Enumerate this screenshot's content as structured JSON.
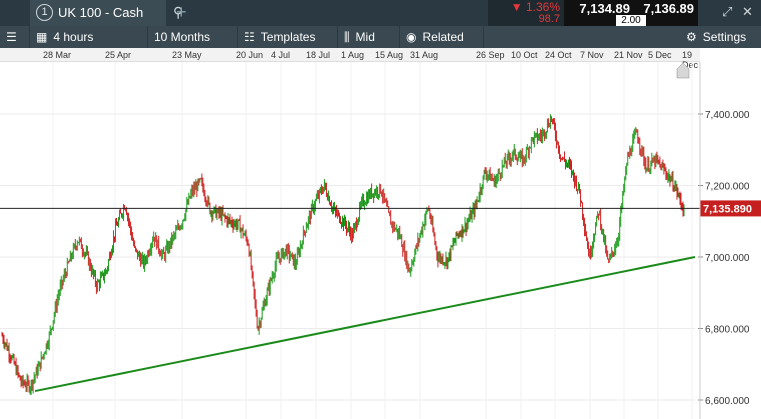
{
  "tab": {
    "number": "1",
    "title": "UK 100 - Cash"
  },
  "quote": {
    "change_pct": "▼ 1.36%",
    "change_pts": "98.7",
    "sell": "7,134.89",
    "buy": "7,136.89",
    "spread": "2.00"
  },
  "toolbar": {
    "interval": "4 hours",
    "range": "10 Months",
    "templates": "Templates",
    "price_type": "Mid",
    "related": "Related",
    "settings": "Settings"
  },
  "date_labels": [
    "28 Mar",
    "25 Apr",
    "23 May",
    "20 Jun",
    "4 Jul",
    "18 Jul",
    "1 Aug",
    "15 Aug",
    "31 Aug",
    "26 Sep",
    "10 Oct",
    "24 Oct",
    "7 Nov",
    "21 Nov",
    "5 Dec",
    "19 Dec"
  ],
  "chart_data": {
    "type": "line",
    "instrument": "UK 100 - Cash",
    "y_ticks": [
      "7,400.000",
      "7,200.000",
      "7,000.000",
      "6,800.000",
      "6,600.000"
    ],
    "ylim": [
      6600,
      7400
    ],
    "current_price_label": "7,135.890",
    "current_price": 7135.89,
    "price_series": [
      6780,
      6720,
      6650,
      6640,
      6700,
      6780,
      6900,
      6980,
      7050,
      7000,
      6920,
      6960,
      7080,
      7150,
      7020,
      6980,
      7060,
      7000,
      7050,
      7100,
      7180,
      7210,
      7130,
      7120,
      7100,
      7090,
      7040,
      6800,
      6900,
      6990,
      7020,
      6980,
      7080,
      7150,
      7200,
      7130,
      7100,
      7060,
      7150,
      7180,
      7190,
      7100,
      7060,
      6960,
      7050,
      7140,
      7000,
      6990,
      7060,
      7090,
      7140,
      7240,
      7210,
      7260,
      7290,
      7270,
      7330,
      7340,
      7390,
      7280,
      7250,
      7180,
      7000,
      7130,
      6980,
      7050,
      7270,
      7350,
      7250,
      7270,
      7240,
      7200,
      7130
    ],
    "trendline": {
      "start_y": 6625,
      "end_y": 7000,
      "color": "#1a8a1a"
    },
    "colors": {
      "up": "#1a9a1a",
      "down": "#d02020",
      "price_label_bg": "#c61f1f"
    }
  }
}
